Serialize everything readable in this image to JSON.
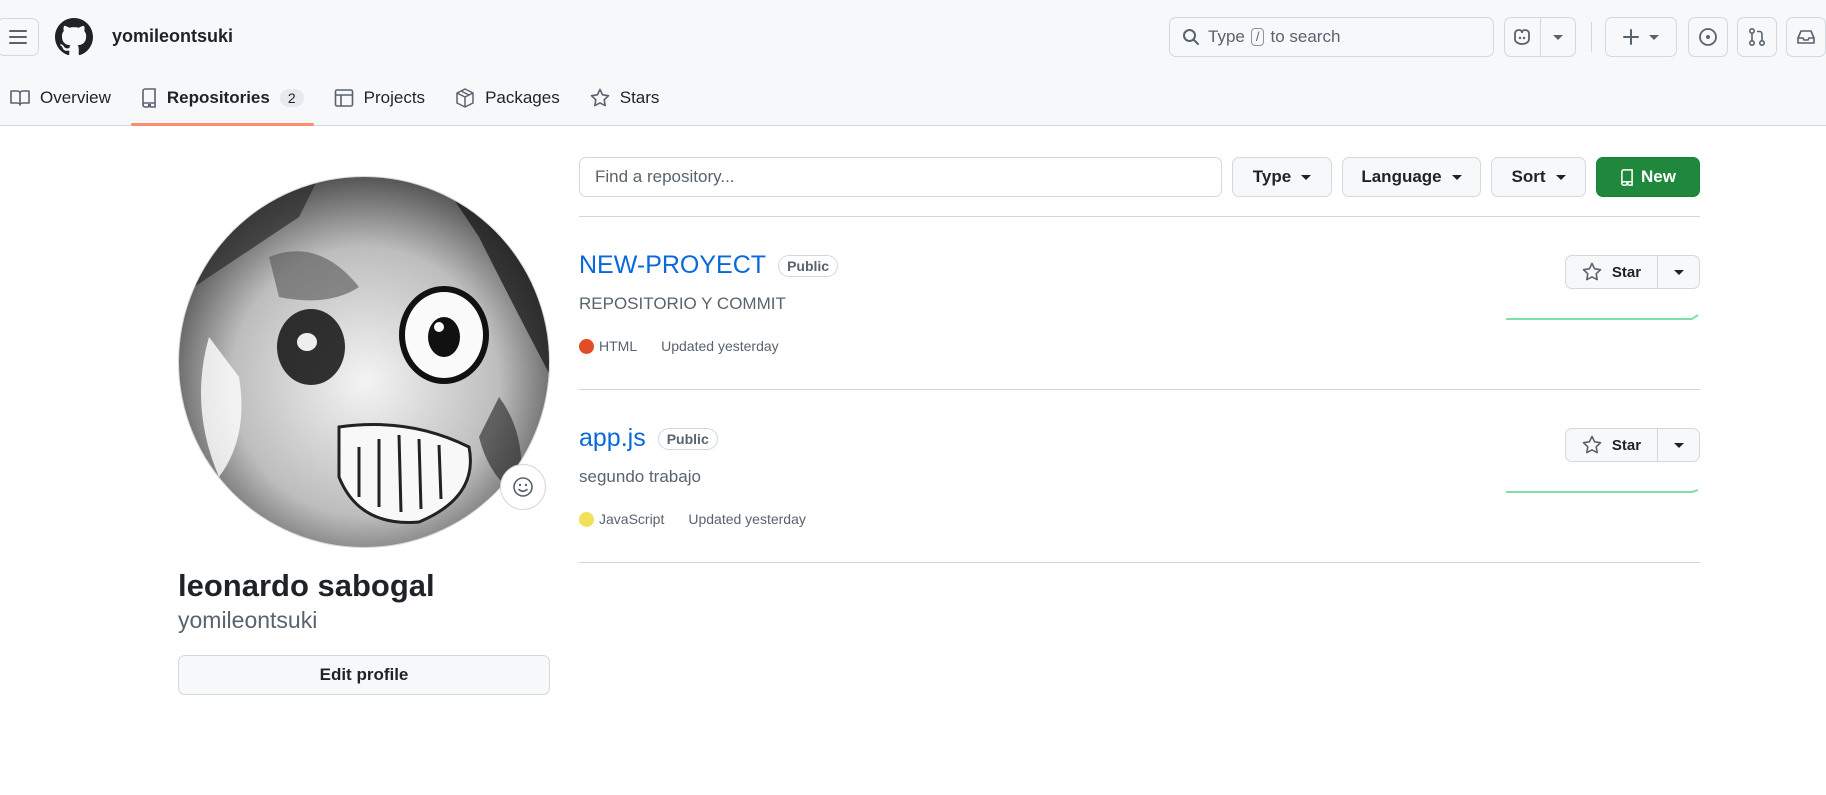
{
  "header": {
    "username": "yomileontsuki",
    "search": {
      "prefix": "Type",
      "key": "/",
      "suffix": "to search"
    }
  },
  "tabs": [
    {
      "label": "Overview",
      "icon": "book-icon"
    },
    {
      "label": "Repositories",
      "icon": "repo-icon",
      "count": "2",
      "selected": true
    },
    {
      "label": "Projects",
      "icon": "table-icon"
    },
    {
      "label": "Packages",
      "icon": "package-icon"
    },
    {
      "label": "Stars",
      "icon": "star-icon"
    }
  ],
  "profile": {
    "full_name": "leonardo sabogal",
    "login": "yomileontsuki",
    "edit_label": "Edit profile"
  },
  "toolbar": {
    "find_placeholder": "Find a repository...",
    "type_label": "Type",
    "language_label": "Language",
    "sort_label": "Sort",
    "new_label": "New"
  },
  "repos": [
    {
      "name": "NEW-PROYECT",
      "visibility": "Public",
      "description": "REPOSITORIO Y COMMIT",
      "language": "HTML",
      "language_color": "#e34c26",
      "updated": "Updated yesterday",
      "star_label": "Star"
    },
    {
      "name": "app.js",
      "visibility": "Public",
      "description": "segundo trabajo",
      "language": "JavaScript",
      "language_color": "#f1e05a",
      "updated": "Updated yesterday",
      "star_label": "Star"
    }
  ],
  "colors": {
    "accent_link": "#0969da",
    "primary_button": "#1f883d",
    "tab_underline": "#fd8c73"
  }
}
